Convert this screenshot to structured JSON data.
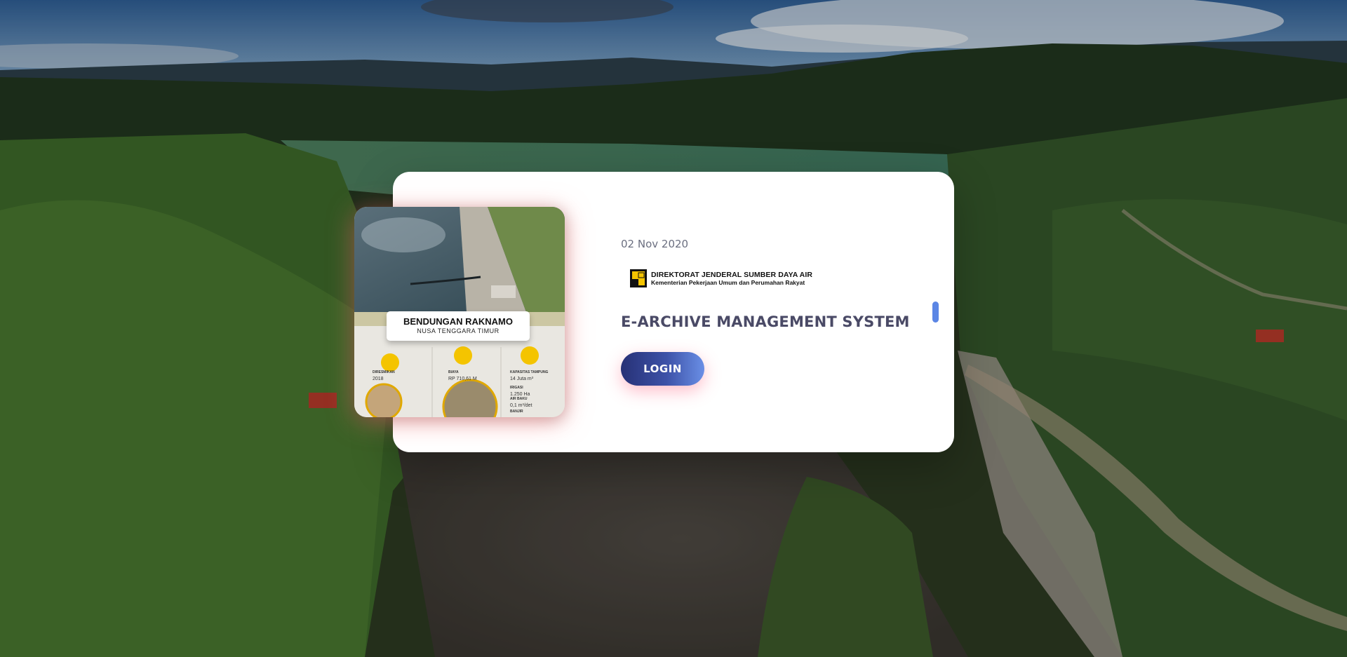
{
  "slide": {
    "date": "02 Nov 2020",
    "logo": {
      "line1": "DIREKTORAT JENDERAL SUMBER DAYA AIR",
      "line2": "Kementerian Pekerjaan Umum dan Perumahan Rakyat"
    },
    "title": "E-ARCHIVE MANAGEMENT SYSTEM",
    "login_label": "LOGIN"
  },
  "thumbnail": {
    "title": "BENDUNGAN RAKNAMO",
    "subtitle": "NUSA TENGGARA TIMUR",
    "stats": [
      {
        "label": "DIRESMIKAN",
        "value": "2018"
      },
      {
        "label": "BIAYA",
        "value": "RP 710,61 M"
      },
      {
        "label": "KAPASITAS TAMPUNG",
        "value": "14 Juta m³"
      },
      {
        "label": "IRIGASI",
        "value": "1.250 Ha"
      },
      {
        "label": "AIR BAKU",
        "value": "0,1 m³/det"
      },
      {
        "label": "BANJIR",
        "value": ""
      }
    ]
  },
  "colors": {
    "accent": "#273176",
    "accent_end": "#6a8fe6",
    "title": "#4a4a66",
    "indicator": "#5b86e5"
  }
}
